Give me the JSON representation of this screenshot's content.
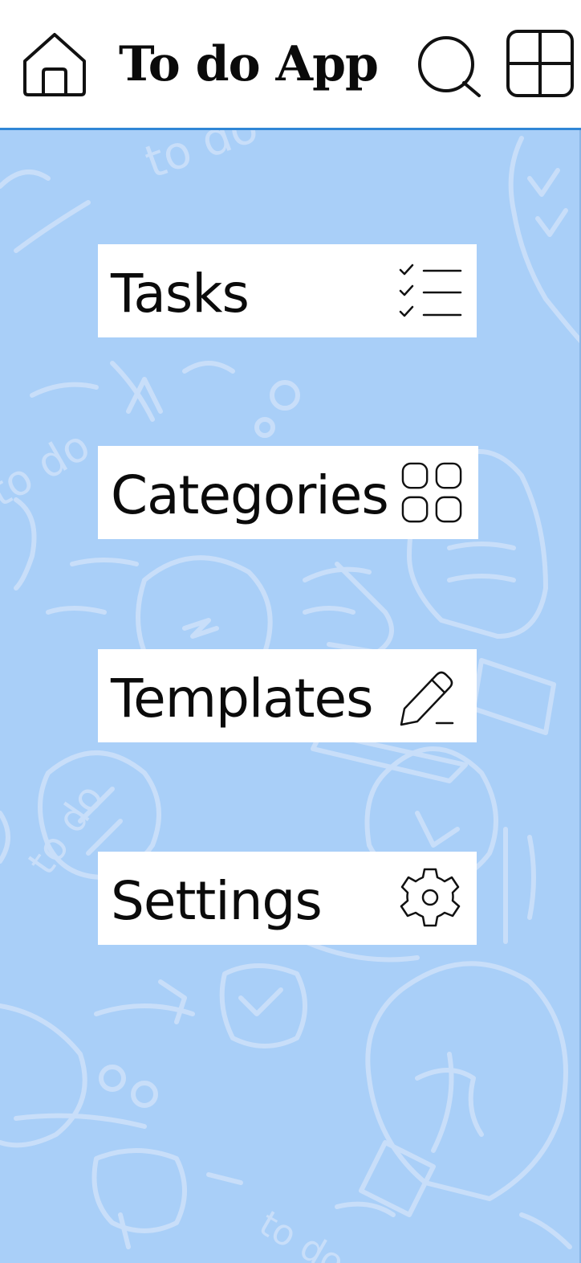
{
  "header": {
    "title": "To do App",
    "icons": {
      "home": "home-icon",
      "search": "search-icon",
      "grid": "grid-icon"
    }
  },
  "menu": {
    "items": [
      {
        "label": "Tasks",
        "icon": "checklist-icon"
      },
      {
        "label": "Categories",
        "icon": "categories-icon"
      },
      {
        "label": "Templates",
        "icon": "pencil-icon"
      },
      {
        "label": "Settings",
        "icon": "gear-icon"
      }
    ]
  },
  "colors": {
    "background": "#a9cff8",
    "header_border": "#2f86d6",
    "doodle": "#cfe3fb"
  }
}
